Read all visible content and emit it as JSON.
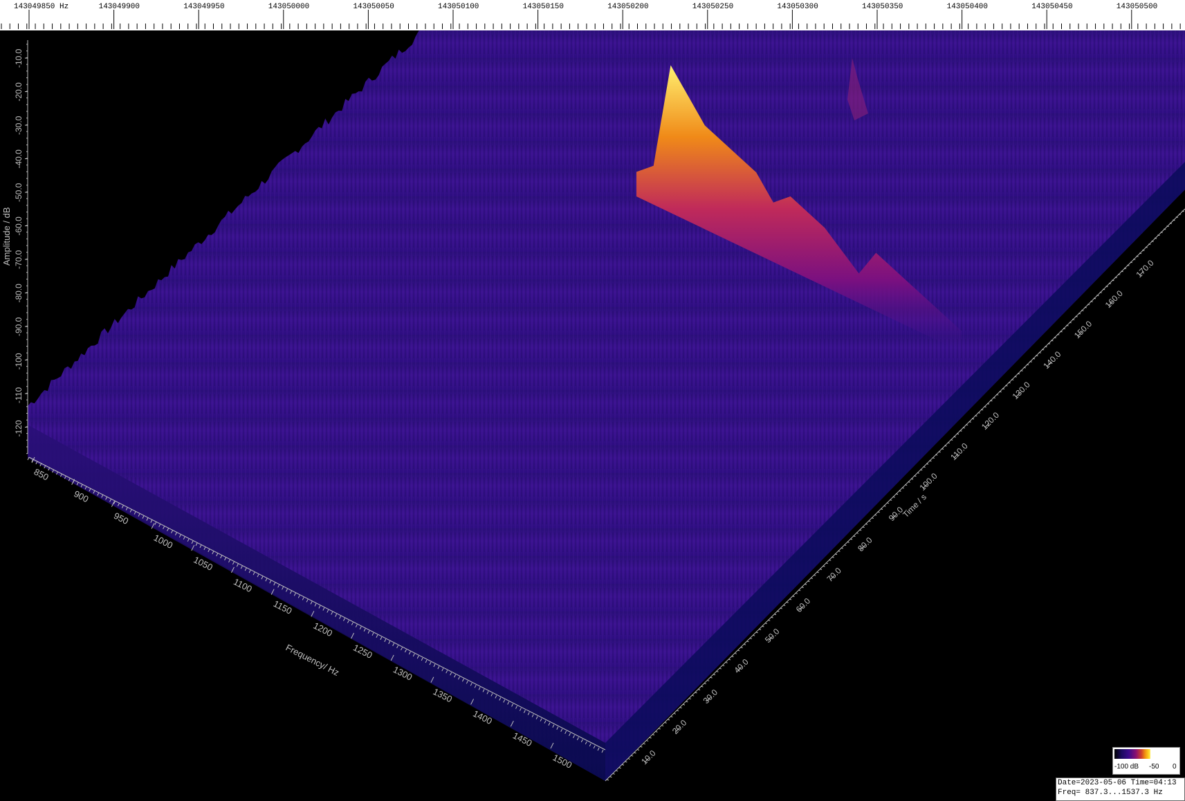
{
  "top_ruler": {
    "unit_label": "Hz",
    "labels": [
      "143049850",
      "143049900",
      "143049950",
      "143050000",
      "143050050",
      "143050100",
      "143050150",
      "143050200",
      "143050250",
      "143050300",
      "143050350",
      "143050400",
      "143050450",
      "143050500"
    ]
  },
  "chart_data": {
    "type": "waterfall-3d",
    "zlabel": "Amplitude / dB",
    "xlabel": "Frequency/ Hz",
    "ylabel": "Time / s",
    "amplitude_ticks": [
      "-10.0",
      "-20.0",
      "-30.0",
      "-40.0",
      "-50.0",
      "-60.0",
      "-70.0",
      "-80.0",
      "-90.0",
      "-100",
      "-110",
      "-120"
    ],
    "frequency_ticks": [
      "850",
      "900",
      "950",
      "1000",
      "1050",
      "1100",
      "1150",
      "1200",
      "1250",
      "1300",
      "1350",
      "1400",
      "1450",
      "1500"
    ],
    "time_ticks": [
      "10.0",
      "20.0",
      "30.0",
      "40.0",
      "50.0",
      "60.0",
      "70.0",
      "80.0",
      "90.0",
      "100.0",
      "110.0",
      "120.0",
      "130.0",
      "140.0",
      "150.0",
      "160.0",
      "170.0"
    ],
    "noise_floor_db": -110,
    "peak_db": -10,
    "signal_trace_profile": [
      0.05,
      0.15,
      0.9,
      0.75,
      0.6,
      0.55,
      0.5,
      0.45,
      0.3,
      0.4,
      0.35,
      0.3,
      0.2,
      0.1,
      0.3,
      0.25,
      0.2,
      0.15,
      0.1,
      0.05
    ],
    "color_scale": {
      "min_label": "-100 dB",
      "mid_label": "-50",
      "max_label": "0"
    }
  },
  "info_box": {
    "line1": "Date=2023-05-06 Time=04:13",
    "line2": "Freq= 837.3...1537.3 Hz"
  }
}
